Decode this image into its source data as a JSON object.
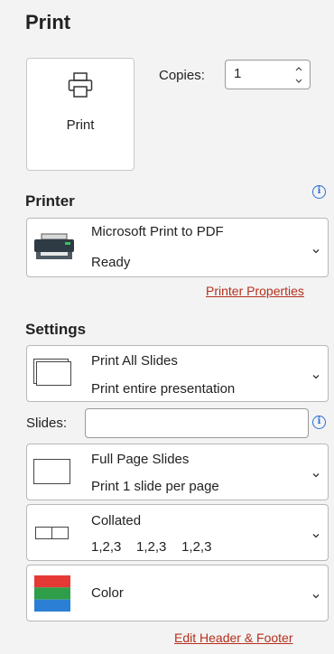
{
  "title": "Print",
  "print_button": {
    "label": "Print"
  },
  "copies": {
    "label": "Copies:",
    "value": "1"
  },
  "printer": {
    "section_label": "Printer",
    "name": "Microsoft Print to PDF",
    "status": "Ready",
    "properties_link": "Printer Properties"
  },
  "settings": {
    "section_label": "Settings",
    "range": {
      "line1": "Print All Slides",
      "line2": "Print entire presentation"
    },
    "slides": {
      "label": "Slides:",
      "value": "",
      "placeholder": ""
    },
    "layout": {
      "line1": "Full Page Slides",
      "line2": "Print 1 slide per page"
    },
    "collation": {
      "line1": "Collated",
      "line2": "1,2,3    1,2,3    1,2,3"
    },
    "color": {
      "label": "Color",
      "swatch_colors": [
        "#e53935",
        "#2e9e48",
        "#2b7fd4"
      ]
    },
    "header_footer_link": "Edit Header & Footer"
  },
  "colors": {
    "link": "#b5301d",
    "info": "#2a6fd6"
  },
  "icons": {
    "print_button": "printer-icon",
    "printer_thumb": "printer-device-icon",
    "info": "info-icon",
    "dropdown": "chevron-down-icon",
    "spinner": "spinner-arrows-icon"
  }
}
